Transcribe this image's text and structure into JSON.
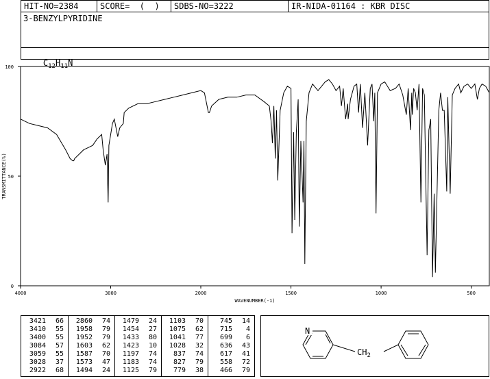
{
  "header": {
    "hit_no": "HIT-NO=2384",
    "score": "SCORE=  (  )",
    "sdbs_no": "SDBS-NO=3222",
    "ir_info": "IR-NIDA-01164 : KBR DISC",
    "compound_name": "3-BENZYLPYRIDINE",
    "formula_c": "C",
    "formula_c_sub": "12",
    "formula_h": "H",
    "formula_h_sub": "11",
    "formula_n": "N"
  },
  "chart_data": {
    "type": "line",
    "xlabel": "WAVENUMBER(-1)",
    "ylabel": "TRANSMITTANCE(%)",
    "xlim": [
      4000,
      400
    ],
    "ylim": [
      0,
      100
    ],
    "x_ticks": [
      "4000",
      "3000",
      "2000",
      "1500",
      "1000",
      "500"
    ],
    "y_ticks": [
      "100",
      "50",
      "0"
    ],
    "series": [
      {
        "x": [
          4000,
          3900,
          3800,
          3700,
          3600,
          3500,
          3450,
          3421,
          3410,
          3400,
          3350,
          3300,
          3250,
          3200,
          3150,
          3100,
          3084,
          3070,
          3059,
          3040,
          3028,
          3020,
          3000,
          2980,
          2960,
          2922,
          2900,
          2860,
          2850,
          2800,
          2700,
          2600,
          2500,
          2400,
          2300,
          2200,
          2100,
          2000,
          1980,
          1958,
          1952,
          1940,
          1900,
          1850,
          1800,
          1750,
          1700,
          1650,
          1620,
          1610,
          1603,
          1595,
          1587,
          1580,
          1573,
          1560,
          1540,
          1520,
          1500,
          1494,
          1485,
          1479,
          1470,
          1460,
          1454,
          1445,
          1433,
          1428,
          1423,
          1415,
          1400,
          1390,
          1380,
          1350,
          1330,
          1310,
          1290,
          1270,
          1250,
          1230,
          1220,
          1210,
          1197,
          1185,
          1183,
          1170,
          1150,
          1135,
          1125,
          1115,
          1103,
          1090,
          1075,
          1060,
          1050,
          1041,
          1035,
          1028,
          1020,
          1000,
          980,
          950,
          920,
          900,
          880,
          860,
          850,
          837,
          830,
          827,
          820,
          810,
          800,
          790,
          779,
          770,
          760,
          745,
          735,
          725,
          715,
          706,
          699,
          690,
          680,
          670,
          660,
          650,
          636,
          630,
          617,
          605,
          590,
          570,
          558,
          540,
          520,
          500,
          480,
          466,
          455,
          440,
          420,
          400
        ],
        "y": [
          76,
          74,
          73,
          72,
          69,
          62,
          58,
          57,
          57,
          58,
          60,
          62,
          63,
          64,
          67,
          69,
          62,
          58,
          55,
          60,
          38,
          64,
          69,
          74,
          76,
          68,
          72,
          74,
          79,
          81,
          83,
          83,
          84,
          85,
          86,
          87,
          88,
          89,
          88,
          79,
          79,
          82,
          85,
          86,
          86,
          87,
          87,
          84,
          82,
          75,
          65,
          82,
          58,
          80,
          48,
          80,
          88,
          91,
          90,
          24,
          70,
          30,
          70,
          85,
          27,
          66,
          38,
          66,
          10,
          75,
          88,
          90,
          92,
          89,
          91,
          93,
          94,
          92,
          89,
          91,
          82,
          90,
          76,
          83,
          76,
          85,
          91,
          92,
          79,
          92,
          72,
          88,
          64,
          90,
          92,
          75,
          88,
          33,
          88,
          92,
          93,
          89,
          90,
          92,
          87,
          78,
          90,
          71,
          88,
          78,
          90,
          88,
          80,
          92,
          38,
          90,
          87,
          14,
          71,
          76,
          4,
          42,
          6,
          42,
          80,
          88,
          80,
          80,
          43,
          86,
          42,
          87,
          90,
          92,
          88,
          91,
          92,
          90,
          92,
          85,
          90,
          92,
          91,
          88
        ]
      }
    ],
    "peak_table": [
      [
        [
          "3421",
          "66"
        ],
        [
          "3410",
          "55"
        ],
        [
          "3400",
          "55"
        ],
        [
          "3084",
          "57"
        ],
        [
          "3059",
          "55"
        ],
        [
          "3028",
          "37"
        ],
        [
          "2922",
          "68"
        ]
      ],
      [
        [
          "2860",
          "74"
        ],
        [
          "1958",
          "79"
        ],
        [
          "1952",
          "79"
        ],
        [
          "1603",
          "62"
        ],
        [
          "1587",
          "70"
        ],
        [
          "1573",
          "47"
        ],
        [
          "1494",
          "24"
        ]
      ],
      [
        [
          "1479",
          "24"
        ],
        [
          "1454",
          "27"
        ],
        [
          "1433",
          "80"
        ],
        [
          "1423",
          "10"
        ],
        [
          "1197",
          "74"
        ],
        [
          "1183",
          "74"
        ],
        [
          "1125",
          "79"
        ]
      ],
      [
        [
          "1103",
          "70"
        ],
        [
          "1075",
          "62"
        ],
        [
          "1041",
          "77"
        ],
        [
          "1028",
          "32"
        ],
        [
          "837",
          "74"
        ],
        [
          "827",
          "79"
        ],
        [
          "779",
          "38"
        ]
      ],
      [
        [
          "745",
          "14"
        ],
        [
          "715",
          "4"
        ],
        [
          "699",
          "6"
        ],
        [
          "636",
          "43"
        ],
        [
          "617",
          "41"
        ],
        [
          "558",
          "72"
        ],
        [
          "466",
          "79"
        ]
      ]
    ],
    "structure": {
      "atom_n": "N",
      "linker": "CH",
      "linker_sub": "2"
    }
  }
}
